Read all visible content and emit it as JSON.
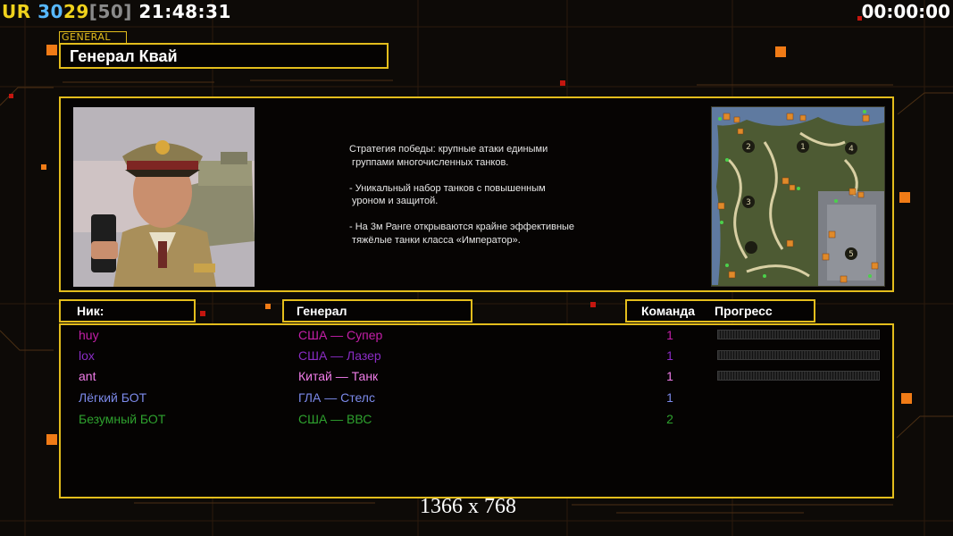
{
  "hud": {
    "ur_label": "UR",
    "stat_a": "30",
    "stat_b": "29",
    "stat_c": "[50]",
    "clock": "21:48:31",
    "timer": "00:00:00"
  },
  "colors": {
    "accent": "#e3bd1c",
    "ur": "#f0d21c",
    "stat_a": "#57b8ff",
    "stat_b": "#f0d21c",
    "stat_c": "#8a8a8a",
    "background": "#0d0a07",
    "orange_square": "#f07b16",
    "red_square": "#c4160f"
  },
  "general": {
    "tag": "GENERAL",
    "name": "Генерал Квай",
    "portrait": "general-kwai-portrait",
    "strategy_lines": [
      "Стратегия победы: крупные атаки едиными",
      " группами многочисленных танков.",
      "",
      "- Уникальный набор танков с повышенным",
      " уроном и защитой.",
      "",
      "- На 3м Ранге открываются крайне эффективные",
      " тяжёлые танки класса «Император»."
    ]
  },
  "minimap": {
    "start_positions": [
      "1",
      "2",
      "3",
      "4",
      "5"
    ]
  },
  "table": {
    "headers": {
      "nick": "Ник:",
      "general": "Генерал",
      "team": "Команда",
      "progress": "Прогресс"
    },
    "rows": [
      {
        "nick": "huy",
        "general": "США — Супер",
        "team": "1",
        "color": "#c41fa8",
        "progress": 0
      },
      {
        "nick": "lox",
        "general": "США — Лазер",
        "team": "1",
        "color": "#8a2cc4",
        "progress": 0
      },
      {
        "nick": "ant",
        "general": "Китай — Танк",
        "team": "1",
        "color": "#f07ce8",
        "progress": 0
      },
      {
        "nick": "Лёгкий БОТ",
        "general": "ГЛА — Стелс",
        "team": "1",
        "color": "#7c8aea",
        "progress": null
      },
      {
        "nick": "Безумный БОТ",
        "general": "США — ВВС",
        "team": "2",
        "color": "#2ea12e",
        "progress": null
      }
    ]
  },
  "resolution_label": "1366 x 768"
}
